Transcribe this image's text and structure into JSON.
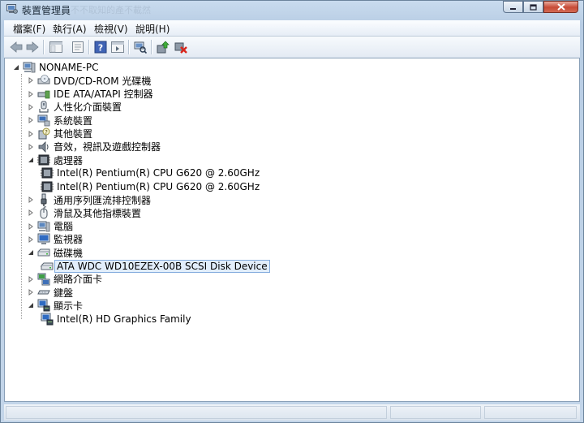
{
  "window": {
    "title": "裝置管理員",
    "ghost_text": "不不取知的產不載然"
  },
  "menu": [
    {
      "label": "檔案(F)"
    },
    {
      "label": "執行(A)"
    },
    {
      "label": "檢視(V)"
    },
    {
      "label": "說明(H)"
    }
  ],
  "toolbar": {
    "buttons": [
      "back-icon",
      "forward-icon",
      "console-tree-icon",
      "properties-icon",
      "help-icon",
      "action-pane-icon",
      "scan-hardware-icon",
      "update-driver-icon",
      "uninstall-icon"
    ]
  },
  "tree": {
    "root": {
      "label": "NONAME-PC",
      "icon": "computer-icon"
    },
    "categories": [
      {
        "label": "DVD/CD-ROM 光碟機",
        "icon": "dvd-drive-icon",
        "expanded": false,
        "children": []
      },
      {
        "label": "IDE ATA/ATAPI 控制器",
        "icon": "ide-controller-icon",
        "expanded": false,
        "children": []
      },
      {
        "label": "人性化介面裝置",
        "icon": "hid-icon",
        "expanded": false,
        "children": []
      },
      {
        "label": "系統裝置",
        "icon": "system-devices-icon",
        "expanded": false,
        "children": []
      },
      {
        "label": "其他裝置",
        "icon": "other-devices-icon",
        "expanded": false,
        "children": []
      },
      {
        "label": "音效，視訊及遊戲控制器",
        "icon": "sound-icon",
        "expanded": false,
        "children": []
      },
      {
        "label": "處理器",
        "icon": "processor-icon",
        "expanded": true,
        "children": [
          {
            "label": "Intel(R) Pentium(R) CPU G620 @ 2.60GHz",
            "icon": "processor-icon"
          },
          {
            "label": "Intel(R) Pentium(R) CPU G620 @ 2.60GHz",
            "icon": "processor-icon"
          }
        ]
      },
      {
        "label": "通用序列匯流排控制器",
        "icon": "usb-icon",
        "expanded": false,
        "children": []
      },
      {
        "label": "滑鼠及其他指標裝置",
        "icon": "mouse-icon",
        "expanded": false,
        "children": []
      },
      {
        "label": "電腦",
        "icon": "computer-icon",
        "expanded": false,
        "children": []
      },
      {
        "label": "監視器",
        "icon": "monitor-icon",
        "expanded": false,
        "children": []
      },
      {
        "label": "磁碟機",
        "icon": "disk-drive-icon",
        "expanded": true,
        "children": [
          {
            "label": "ATA WDC WD10EZEX-00B SCSI Disk Device",
            "icon": "disk-drive-icon",
            "selected": true
          }
        ]
      },
      {
        "label": "網路介面卡",
        "icon": "network-adapter-icon",
        "expanded": false,
        "children": []
      },
      {
        "label": "鍵盤",
        "icon": "keyboard-icon",
        "expanded": false,
        "children": []
      },
      {
        "label": "顯示卡",
        "icon": "display-adapter-icon",
        "expanded": true,
        "children": [
          {
            "label": "Intel(R) HD Graphics Family",
            "icon": "display-adapter-icon"
          }
        ]
      }
    ]
  },
  "colors": {
    "selection_bg": "#e2eefb",
    "selection_border": "#84acdd",
    "close_button": "#c74a36"
  }
}
